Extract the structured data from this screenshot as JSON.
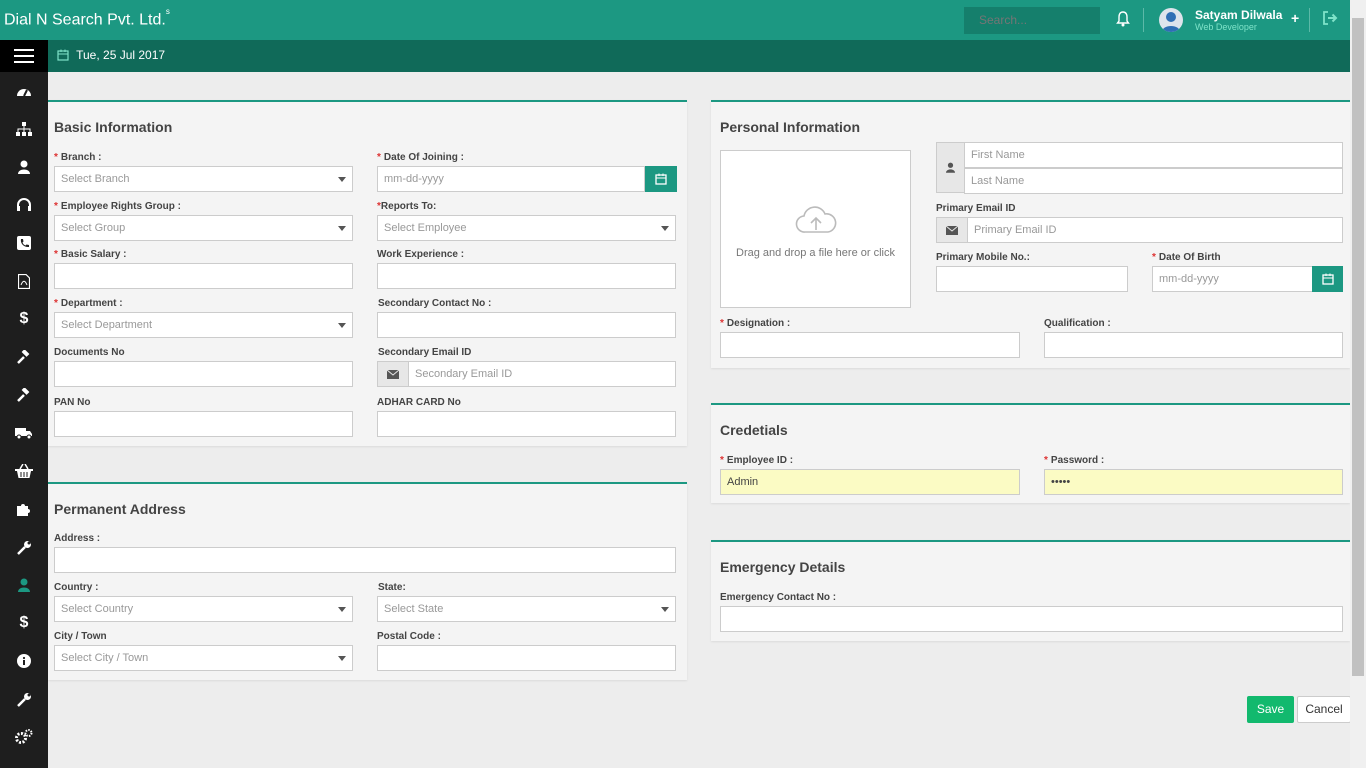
{
  "app": {
    "brand": "Dial N Search Pvt. Ltd.",
    "brand_sup": "s",
    "search_placeholder": "Search...",
    "user_name": "Satyam Dilwala",
    "user_role": "Web Developer",
    "plus_label": "+",
    "date": "Tue, 25 Jul 2017",
    "accent": "#1c9882"
  },
  "sidebar": {
    "icons": [
      "dashboard-icon",
      "sitemap-icon",
      "user-icon",
      "headset-icon",
      "phone-icon",
      "pdf-icon",
      "dollar-icon",
      "gavel-icon",
      "gavel-icon",
      "truck-icon",
      "basket-icon",
      "puzzle-icon",
      "wrench-icon",
      "user-icon",
      "dollar-icon",
      "info-icon",
      "wrench-icon",
      "gears-icon"
    ],
    "active_index": 13
  },
  "basic": {
    "title": "Basic Information",
    "branch_label": "Branch :",
    "branch_value": "Select Branch",
    "doj_label": "Date Of Joining :",
    "doj_placeholder": "mm-dd-yyyy",
    "rights_label": "Employee Rights Group :",
    "rights_value": "Select Group",
    "reports_label": "Reports To:",
    "reports_value": "Select Employee",
    "salary_label": "Basic Salary :",
    "experience_label": "Work Experience :",
    "department_label": "Department :",
    "department_value": "Select Department",
    "sec_contact_label": "Secondary Contact No :",
    "documents_label": "Documents No",
    "sec_email_label": "Secondary Email ID",
    "sec_email_placeholder": "Secondary Email ID",
    "pan_label": "PAN No",
    "adhar_label": "ADHAR CARD No"
  },
  "address": {
    "title": "Permanent Address",
    "address_label": "Address :",
    "country_label": "Country :",
    "country_value": "Select Country",
    "state_label": "State:",
    "state_value": "Select State",
    "city_label": "City / Town",
    "city_value": "Select City / Town",
    "postal_label": "Postal Code :"
  },
  "personal": {
    "title": "Personal Information",
    "drop_text": "Drag and drop a file here or click",
    "first_name_placeholder": "First Name",
    "last_name_placeholder": "Last Name",
    "email_label": "Primary Email ID",
    "email_placeholder": "Primary Email ID",
    "mobile_label": "Primary Mobile No.:",
    "dob_label": "Date Of Birth",
    "dob_placeholder": "mm-dd-yyyy",
    "designation_label": "Designation :",
    "qualification_label": "Qualification :"
  },
  "credentials": {
    "title": "Credetials",
    "employee_id_label": "Employee ID :",
    "employee_id_value": "Admin",
    "password_label": "Password :",
    "password_value": "•••••"
  },
  "emergency": {
    "title": "Emergency Details",
    "contact_label": "Emergency Contact No :"
  },
  "actions": {
    "save": "Save",
    "cancel": "Cancel"
  }
}
